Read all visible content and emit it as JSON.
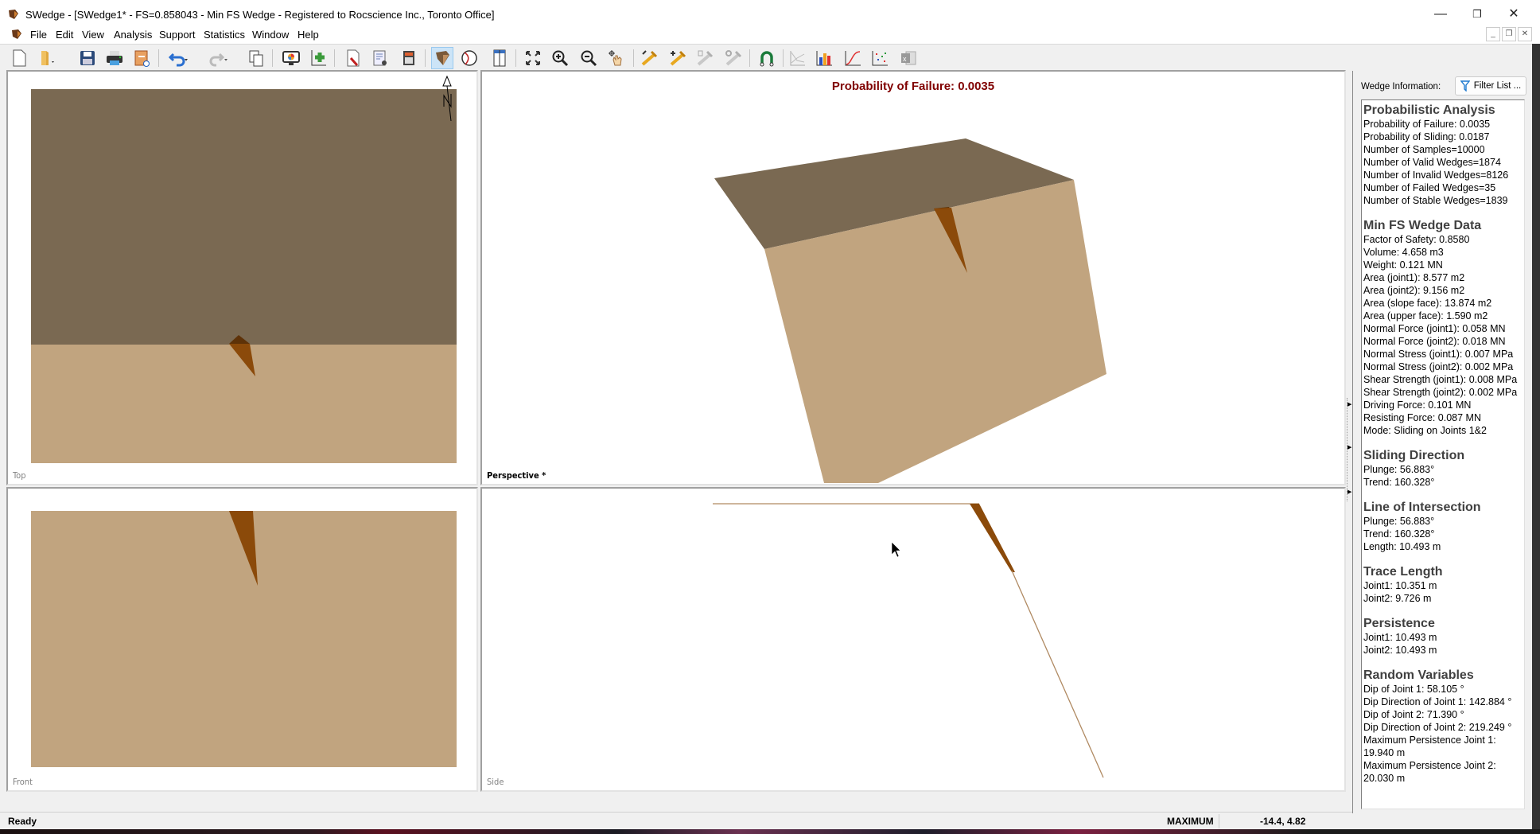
{
  "window": {
    "title": "SWedge - [SWedge1* - FS=0.858043 - Min FS Wedge - Registered to Rocscience Inc., Toronto Office]",
    "controls": {
      "minimize": "—",
      "restore": "❐",
      "close": "✕"
    },
    "mdi_controls": {
      "minimize": "_",
      "restore": "❐",
      "close": "✕"
    }
  },
  "menu": [
    "File",
    "Edit",
    "View",
    "Analysis",
    "Support",
    "Statistics",
    "Window",
    "Help"
  ],
  "toolbar": {
    "buttons": [
      {
        "name": "new-file-icon"
      },
      {
        "name": "open-folder-icon"
      },
      {
        "name": "save-icon"
      },
      {
        "name": "print-icon"
      },
      {
        "name": "export-report-icon"
      },
      {
        "name": "undo-icon"
      },
      {
        "name": "redo-icon"
      },
      {
        "name": "copy-icon"
      },
      {
        "name": "display-options-icon"
      },
      {
        "name": "add-chart-icon"
      },
      {
        "name": "input-data-icon"
      },
      {
        "name": "project-settings-icon"
      },
      {
        "name": "calculator-icon"
      },
      {
        "name": "wedge-view-icon",
        "active": true
      },
      {
        "name": "stereonet-icon"
      },
      {
        "name": "four-view-icon"
      },
      {
        "name": "zoom-extents-icon"
      },
      {
        "name": "zoom-in-icon"
      },
      {
        "name": "zoom-out-icon"
      },
      {
        "name": "pan-icon"
      },
      {
        "name": "edit-bolt-icon"
      },
      {
        "name": "add-bolt-icon"
      },
      {
        "name": "delete-bolt-icon"
      },
      {
        "name": "bolt-properties-icon"
      },
      {
        "name": "magnet-icon"
      },
      {
        "name": "sensitivity-plot-icon"
      },
      {
        "name": "histogram-icon"
      },
      {
        "name": "cumulative-plot-icon"
      },
      {
        "name": "scatter-plot-icon"
      },
      {
        "name": "excel-export-icon"
      }
    ]
  },
  "views": {
    "top": {
      "label": "Top",
      "north_label": "N"
    },
    "perspective": {
      "label": "Perspective *",
      "headline": "Probability of Failure: 0.0035"
    },
    "front": {
      "label": "Front"
    },
    "side": {
      "label": "Side"
    }
  },
  "colors": {
    "upper_face": "#7a6952",
    "slope_face": "#c1a47f",
    "wedge": "#8b4a0a",
    "wedge_dark": "#5e3208",
    "headline": "#800000"
  },
  "right_panel": {
    "label": "Wedge Information:",
    "filter_button": "Filter List ...",
    "sections": [
      {
        "title": "Probabilistic Analysis",
        "rows": [
          "Probability of Failure: 0.0035",
          "Probability of Sliding: 0.0187",
          "Number of Samples=10000",
          "Number of Valid Wedges=1874",
          "Number of Invalid Wedges=8126",
          "Number of Failed Wedges=35",
          "Number of Stable Wedges=1839"
        ]
      },
      {
        "title": "Min FS Wedge Data",
        "rows": [
          "Factor of Safety: 0.8580",
          "Volume: 4.658 m3",
          "Weight: 0.121 MN",
          "Area (joint1): 8.577 m2",
          "Area (joint2): 9.156 m2",
          "Area (slope face): 13.874 m2",
          "Area (upper face): 1.590 m2",
          "Normal Force (joint1): 0.058 MN",
          "Normal Force (joint2): 0.018 MN",
          "Normal Stress (joint1): 0.007 MPa",
          "Normal Stress (joint2): 0.002 MPa",
          "Shear Strength (joint1): 0.008 MPa",
          "Shear Strength (joint2): 0.002 MPa",
          "Driving Force: 0.101 MN",
          "Resisting Force: 0.087 MN",
          "Mode: Sliding on Joints 1&2"
        ]
      },
      {
        "title": "Sliding Direction",
        "rows": [
          "Plunge: 56.883°",
          "Trend: 160.328°"
        ]
      },
      {
        "title": "Line of Intersection",
        "rows": [
          "Plunge: 56.883°",
          "Trend: 160.328°",
          "Length: 10.493 m"
        ]
      },
      {
        "title": "Trace Length",
        "rows": [
          "Joint1: 10.351 m",
          "Joint2: 9.726 m"
        ]
      },
      {
        "title": "Persistence",
        "rows": [
          "Joint1: 10.493 m",
          "Joint2: 10.493 m"
        ]
      },
      {
        "title": "Random Variables",
        "rows": [
          "Dip of Joint 1: 58.105 °",
          "Dip Direction of Joint 1: 142.884 °",
          "Dip of Joint 2: 71.390 °",
          "Dip Direction of Joint 2: 219.249 °",
          "Maximum Persistence Joint 1:",
          "19.940 m",
          "Maximum Persistence Joint 2:",
          "20.030 m"
        ]
      }
    ]
  },
  "status": {
    "ready": "Ready",
    "mode": "MAXIMUM",
    "coords": "-14.4, 4.82"
  }
}
